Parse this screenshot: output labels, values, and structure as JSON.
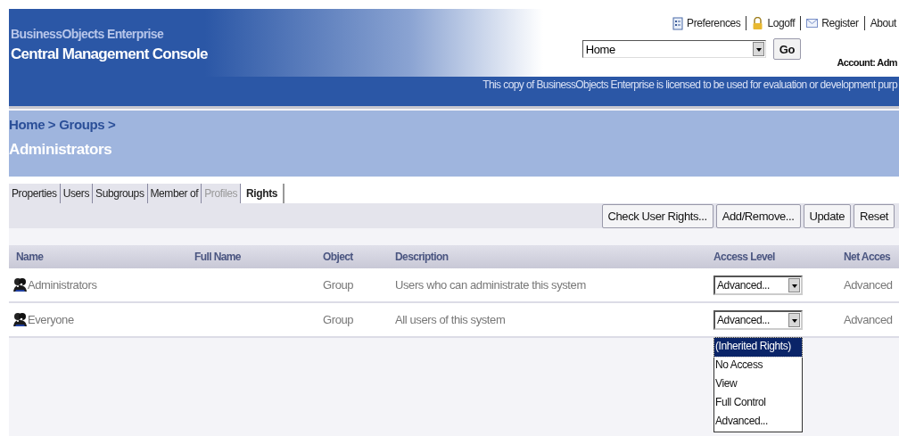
{
  "header": {
    "product": "BusinessObjects Enterprise",
    "title": "Central Management Console",
    "links": [
      {
        "label": "Preferences"
      },
      {
        "label": "Logoff"
      },
      {
        "label": "Register"
      },
      {
        "label": "About"
      }
    ],
    "navigation": {
      "value": "Home",
      "button": "Go"
    },
    "account": "Account: Adm",
    "license_notice": "This copy of BusinessObjects Enterprise is licensed to be used for evaluation or development purp"
  },
  "breadcrumb": [
    "Home >",
    "Groups >"
  ],
  "page_title": "Administrators",
  "tabs": [
    {
      "label": "Properties",
      "selected": false,
      "disabled": false
    },
    {
      "label": "Users",
      "selected": false,
      "disabled": false
    },
    {
      "label": "Subgroups",
      "selected": false,
      "disabled": false
    },
    {
      "label": "Member of",
      "selected": false,
      "disabled": false
    },
    {
      "label": "Profiles",
      "selected": false,
      "disabled": true
    },
    {
      "label": "Rights",
      "selected": true,
      "disabled": false
    }
  ],
  "toolbar": [
    "Check User Rights...",
    "Add/Remove...",
    "Update",
    "Reset"
  ],
  "table": {
    "columns": [
      "Name",
      "Full Name",
      "Object",
      "Description",
      "Access Level",
      "Net Acces"
    ],
    "rows": [
      {
        "name": "Administrators",
        "object": "Group",
        "description": "Users who can administrate this system",
        "access_level": "Advanced...",
        "net_access": "Advanced"
      },
      {
        "name": "Everyone",
        "object": "Group",
        "description": "All users of this system",
        "access_level": "Advanced...",
        "net_access": "Advanced",
        "options": [
          {
            "label": "(Inherited Rights)",
            "selected": true
          },
          {
            "label": "No Access",
            "selected": false
          },
          {
            "label": "View",
            "selected": false
          },
          {
            "label": "Full Control",
            "selected": false
          },
          {
            "label": "Advanced...",
            "selected": false
          }
        ]
      }
    ]
  }
}
